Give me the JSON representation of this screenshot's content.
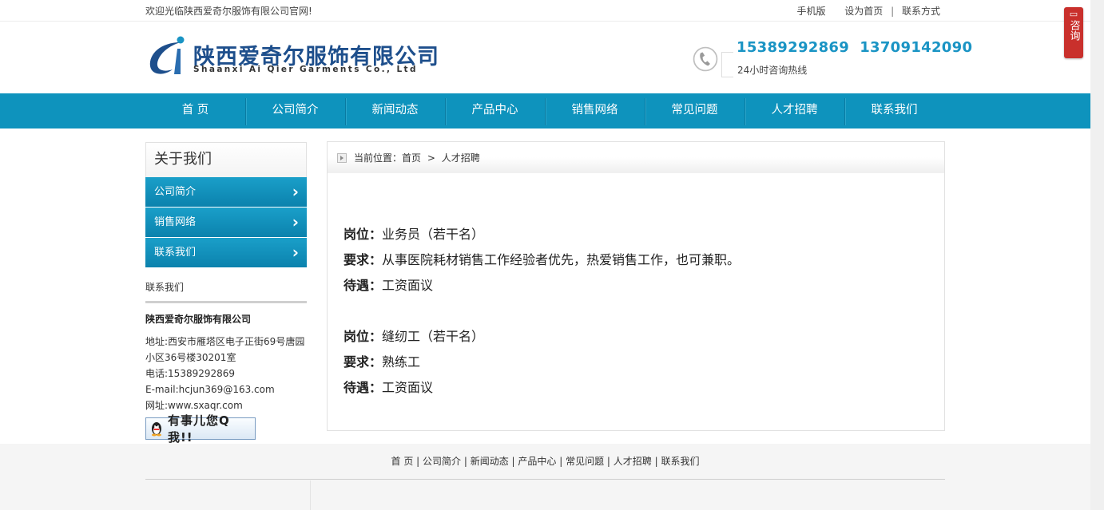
{
  "topbar": {
    "welcome": "欢迎光临陕西爱奇尔服饰有限公司官网!",
    "links": [
      "手机版",
      "设为首页",
      "联系方式"
    ]
  },
  "header": {
    "logo_cn": "陕西爱奇尔服饰有限公司",
    "logo_en": "Shaanxi Ai Qier Garments Co., Ltd",
    "hotline_numbers": "15389292869  13709142090",
    "hotline_sub": "24小时咨询热线"
  },
  "nav": {
    "items": [
      "首 页",
      "公司简介",
      "新闻动态",
      "产品中心",
      "销售网络",
      "常见问题",
      "人才招聘",
      "联系我们"
    ]
  },
  "sidebar": {
    "title": "关于我们",
    "menu": [
      "公司简介",
      "销售网络",
      "联系我们"
    ],
    "contact_heading": "联系我们",
    "company": "陕西爱奇尔服饰有限公司",
    "address": "地址:西安市雁塔区电子正街69号唐园小区36号楼30201室",
    "phone": "电话:15389292869",
    "email": "E-mail:hcjun369@163.com",
    "website": "网址:www.sxaqr.com",
    "qq_label": "有事儿您Q我!!"
  },
  "breadcrumb": {
    "prefix": "当前位置：",
    "home": "首页",
    "sep": ">",
    "current": "人才招聘"
  },
  "jobs": [
    {
      "position_label": "岗位：",
      "position": "业务员（若干名）",
      "requirement_label": "要求：",
      "requirement": "从事医院耗材销售工作经验者优先，热爱销售工作，也可兼职。",
      "benefit_label": "待遇：",
      "benefit": "工资面议"
    },
    {
      "position_label": "岗位：",
      "position": "缝纫工（若干名）",
      "requirement_label": "要求：",
      "requirement": "熟练工",
      "benefit_label": "待遇：",
      "benefit": "工资面议"
    }
  ],
  "footer": {
    "links": [
      "首 页",
      "公司简介",
      "新闻动态",
      "产品中心",
      "常见问题",
      "人才招聘",
      "联系我们"
    ]
  },
  "float_consult": {
    "label": "咨询"
  },
  "colors": {
    "nav": "#0e93bd",
    "accent": "#1a94c4",
    "logo": "#1e4f8c",
    "consult": "#c9302c"
  }
}
